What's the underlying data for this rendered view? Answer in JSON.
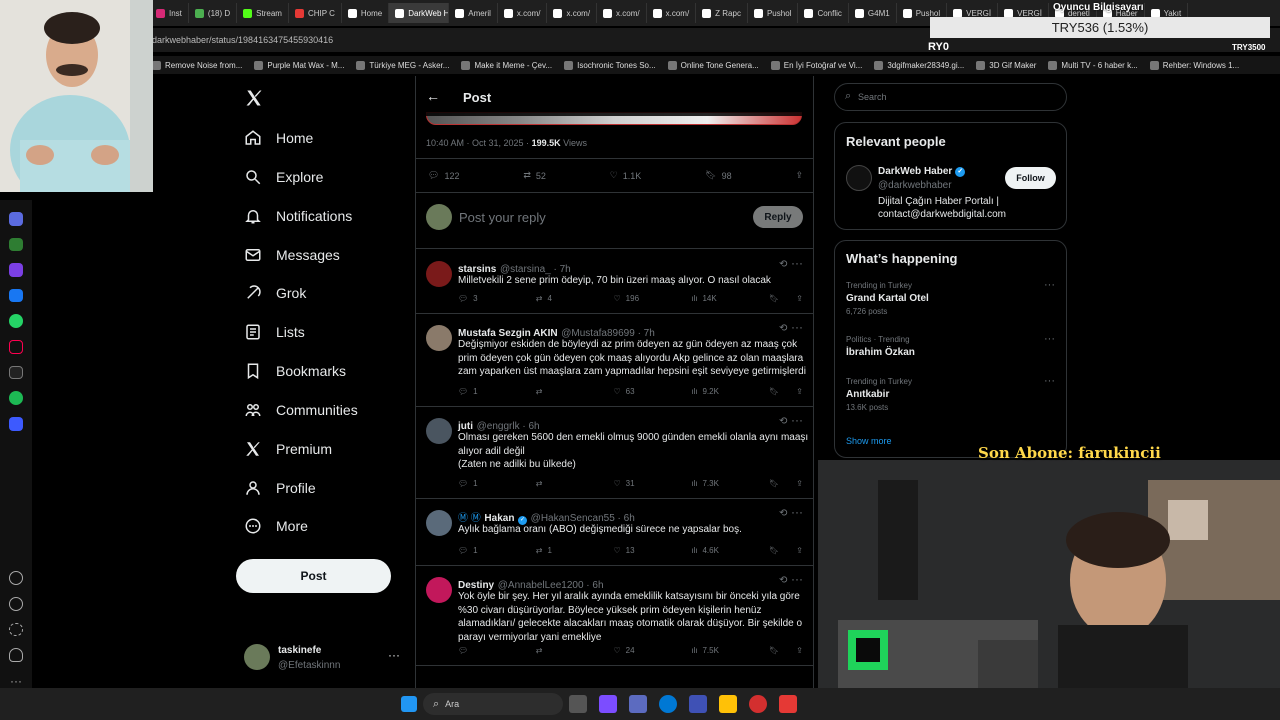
{
  "browser": {
    "tabs": [
      {
        "label": "Inst",
        "color": "#d62976"
      },
      {
        "label": "(18) D",
        "color": "#4caf50"
      },
      {
        "label": "Stream",
        "color": "#53fc18"
      },
      {
        "label": "CHIP C",
        "color": "#e53935"
      },
      {
        "label": "Home",
        "color": "#ffffff"
      },
      {
        "label": "DarkWeb Ha",
        "color": "#ffffff",
        "active": true
      },
      {
        "label": "Ameril",
        "color": "#ffffff"
      },
      {
        "label": "x.com/",
        "color": "#ffffff"
      },
      {
        "label": "x.com/",
        "color": "#ffffff"
      },
      {
        "label": "x.com/",
        "color": "#ffffff"
      },
      {
        "label": "x.com/",
        "color": "#ffffff"
      },
      {
        "label": "Z Rapc",
        "color": "#ffffff"
      },
      {
        "label": "Pushol",
        "color": "#ffffff"
      },
      {
        "label": "Conflic",
        "color": "#ffffff"
      },
      {
        "label": "G4M1",
        "color": "#ffffff"
      },
      {
        "label": "Pushol",
        "color": "#ffffff"
      },
      {
        "label": "VERGİ",
        "color": "#ffffff"
      },
      {
        "label": "VERGİ",
        "color": "#ffffff"
      },
      {
        "label": "denetl",
        "color": "#ffffff"
      },
      {
        "label": "Haber",
        "color": "#ffffff"
      },
      {
        "label": "Yakıt",
        "color": "#ffffff"
      }
    ],
    "url": "darkwebhaber/status/1984163475455930416",
    "bookmarks": [
      "Remove Noise from...",
      "Purple Mat Wax - M...",
      "Türkiye MEG - Asker...",
      "Make it Meme - Çev...",
      "Isochronic Tones So...",
      "Online Tone Genera...",
      "En İyi Fotoğraf ve Vi...",
      "3dgifmaker28349.gi...",
      "3D Gif Maker",
      "Multi TV - 6 haber k...",
      "Rehber: Windows 1..."
    ],
    "overlay_top": "Oyuncu Bilgisayarı",
    "overlay_codes": [
      "RY0",
      "TRY3500"
    ]
  },
  "ticker": "TRY536 (1.53%)",
  "sub_label": "Son Abone: farukincii",
  "nav": {
    "items": [
      {
        "label": "Home",
        "icon": "home-icon"
      },
      {
        "label": "Explore",
        "icon": "search-icon"
      },
      {
        "label": "Notifications",
        "icon": "bell-icon"
      },
      {
        "label": "Messages",
        "icon": "mail-icon"
      },
      {
        "label": "Grok",
        "icon": "grok-icon"
      },
      {
        "label": "Lists",
        "icon": "list-icon"
      },
      {
        "label": "Bookmarks",
        "icon": "bookmark-icon"
      },
      {
        "label": "Communities",
        "icon": "communities-icon"
      },
      {
        "label": "Premium",
        "icon": "x-logo-icon"
      },
      {
        "label": "Profile",
        "icon": "person-icon"
      },
      {
        "label": "More",
        "icon": "more-circle-icon"
      }
    ],
    "post_label": "Post",
    "account": {
      "name": "taskinefe",
      "handle": "@Efetaskinnn"
    }
  },
  "post": {
    "header_title": "Post",
    "meta": "10:40 AM · Oct 31, 2025 · ",
    "views_count": "199.5K",
    "views_label": "Views",
    "stats": {
      "replies": "122",
      "reposts": "52",
      "likes": "1.1K",
      "bookmarks": "98"
    },
    "reply_placeholder": "Post your reply",
    "reply_button": "Reply"
  },
  "replies": [
    {
      "name": "starsins",
      "handle": "@starsina_ · 7h",
      "lines": [
        "Milletvekili 2 sene prim ödeyip, 70 bin üzeri maaş alıyor. O nasıl olacak"
      ],
      "replies": "3",
      "reposts": "4",
      "likes": "196",
      "views": "14K",
      "avatar": "#7a1a1a"
    },
    {
      "name": "Mustafa Sezgin AKIN",
      "handle": "@Mustafa89699 · 7h",
      "lines": [
        "Değişmiyor eskiden de böyleydi az prim ödeyen az gün ödeyen az maaş çok",
        "prim ödeyen çok gün ödeyen çok maaş alıyordu Akp gelince az olan maaşlara",
        "zam yaparken üst maaşlara zam yapmadılar hepsini eşit seviyeye getirmişlerdi"
      ],
      "replies": "1",
      "reposts": "",
      "likes": "63",
      "views": "9.2K",
      "avatar": "#8a7a6a"
    },
    {
      "name": "juti",
      "handle": "@enggrlk · 6h",
      "lines": [
        "Olması gereken 5600 den emekli olmuş 9000 günden emekli olanla aynı maaşı",
        "alıyor adil değil",
        "(Zaten ne adilki bu ülkede)"
      ],
      "replies": "1",
      "reposts": "",
      "likes": "31",
      "views": "7.3K",
      "avatar": "#4a5560"
    },
    {
      "name": "Hakan",
      "prefix": "Ⓜ Ⓜ",
      "handle": "@HakanSencan55 · 6h",
      "lines": [
        "Aylık bağlama oranı (ABO) değişmediği sürece ne yapsalar boş."
      ],
      "replies": "1",
      "reposts": "1",
      "likes": "13",
      "views": "4.6K",
      "avatar": "#5a6a7a"
    },
    {
      "name": "Destiny",
      "handle": "@AnnabelLee1200 · 6h",
      "lines": [
        "Yok öyle bir şey. Her yıl aralık ayında emeklilik katsayısını bir önceki yıla göre",
        "%30 civarı düşürüyorlar. Böylece yüksek prim ödeyen kişilerin henüz",
        "alamadıkları/ gelecekte alacakları maaş otomatik olarak düşüyor. Bir şekilde o",
        "parayı vermiyorlar yani emekliye"
      ],
      "replies": "",
      "reposts": "",
      "likes": "24",
      "views": "7.5K",
      "avatar": "#c2185b"
    }
  ],
  "right": {
    "search_placeholder": "Search",
    "relevant_title": "Relevant people",
    "person": {
      "name": "DarkWeb Haber",
      "handle": "@darkwebhaber",
      "bio1": "Dijital Çağın Haber Portalı |",
      "bio2": "contact@darkwebdigital.com",
      "follow": "Follow"
    },
    "happening_title": "What’s happening",
    "trends": [
      {
        "context": "Trending in Turkey",
        "title": "Grand Kartal Otel",
        "count": "6,726 posts"
      },
      {
        "context": "Politics · Trending",
        "title": "İbrahim Özkan",
        "count": ""
      },
      {
        "context": "Trending in Turkey",
        "title": "Anıtkabir",
        "count": "13.6K posts"
      }
    ],
    "show_more": "Show more"
  },
  "taskbar": {
    "search": "Ara"
  },
  "colors": {
    "accent": "#1d9bf0",
    "bg": "#000000",
    "border": "#2f3336",
    "muted": "#71767b"
  }
}
